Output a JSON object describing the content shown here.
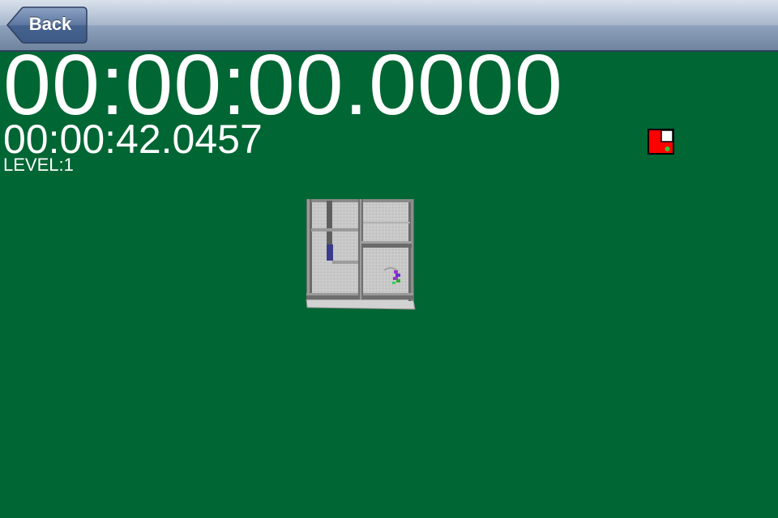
{
  "navbar": {
    "back_label": "Back"
  },
  "hud": {
    "main_timer": "00:00:00.0000",
    "best_timer": "00:00:42.0457",
    "level_label": "LEVEL:1"
  },
  "minimap": {
    "icon": "level-minimap-icon",
    "colors": {
      "background": "#ff0000",
      "goal": "#ffffff",
      "ball": "#33cc33",
      "border": "#000000"
    }
  },
  "maze": {
    "icon": "maze-board",
    "colors": {
      "floor": "#c9c9c9",
      "wall": "#6b6b6b",
      "wall_top": "#9a9a9a",
      "ball": "#9933cc"
    }
  },
  "colors": {
    "background": "#006633",
    "text": "#ffffff",
    "navbar": "#8fa2bd"
  }
}
